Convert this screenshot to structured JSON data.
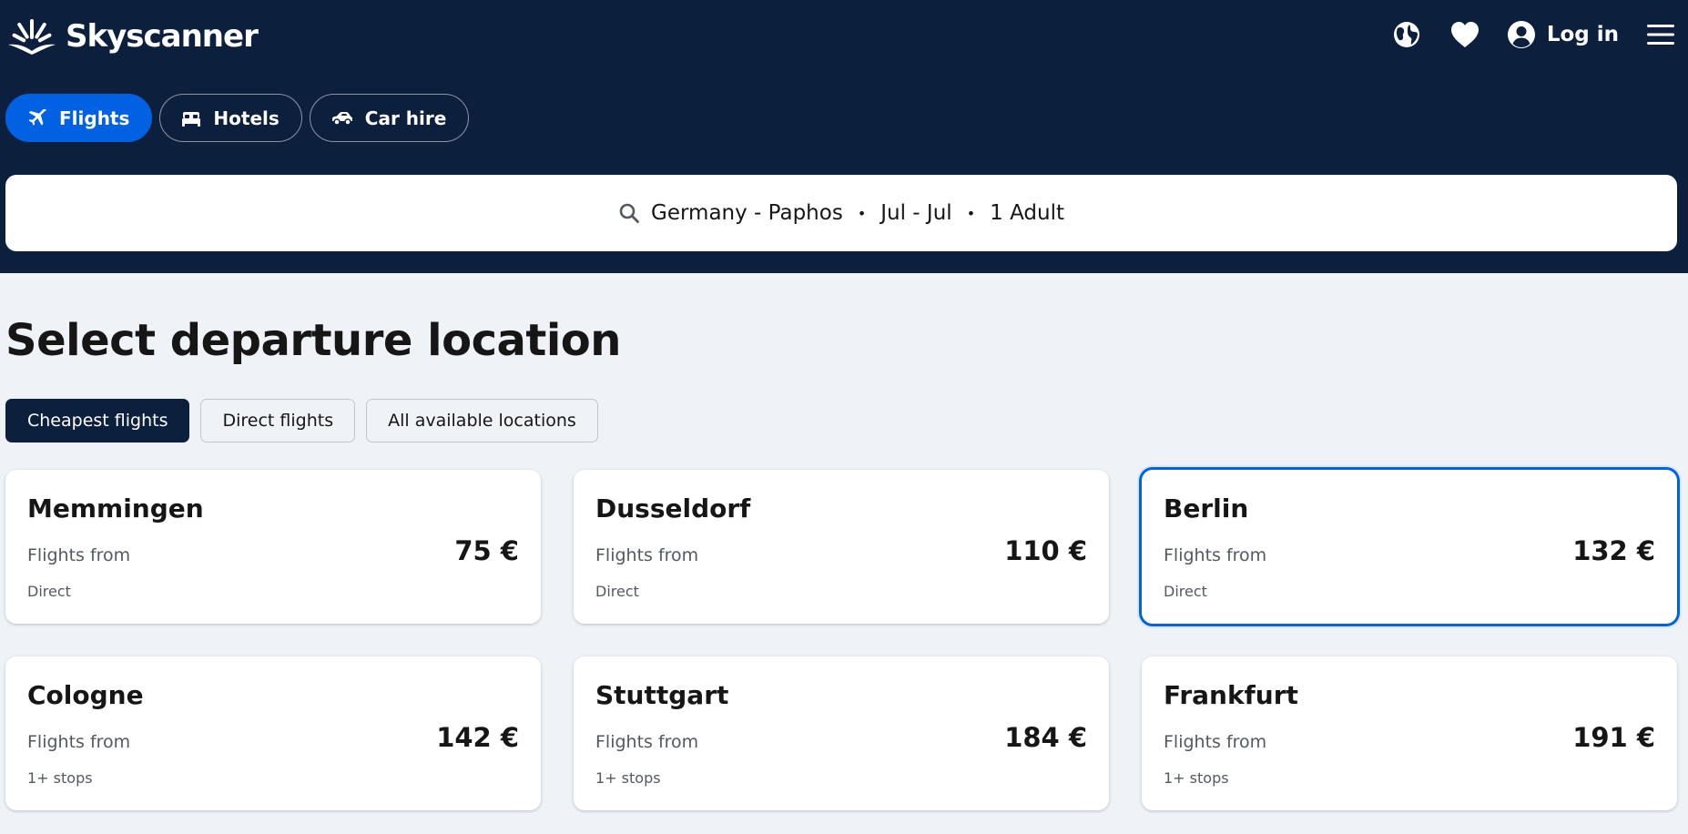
{
  "header": {
    "brand": "Skyscanner",
    "login_label": "Log in",
    "icons": [
      "globe-icon",
      "heart-icon",
      "account-icon",
      "menu-icon"
    ]
  },
  "tabs": [
    {
      "label": "Flights",
      "icon": "plane-icon",
      "active": true
    },
    {
      "label": "Hotels",
      "icon": "bed-icon",
      "active": false
    },
    {
      "label": "Car hire",
      "icon": "car-icon",
      "active": false
    }
  ],
  "search": {
    "route": "Germany - Paphos",
    "dates": "Jul - Jul",
    "travellers": "1 Adult",
    "separator": "•"
  },
  "main": {
    "title": "Select departure location",
    "filters": [
      {
        "label": "Cheapest flights",
        "active": true
      },
      {
        "label": "Direct flights",
        "active": false
      },
      {
        "label": "All available locations",
        "active": false
      }
    ],
    "cards": [
      {
        "city": "Memmingen",
        "from_label": "Flights from",
        "price": "75 €",
        "stops": "Direct",
        "selected": false
      },
      {
        "city": "Dusseldorf",
        "from_label": "Flights from",
        "price": "110 €",
        "stops": "Direct",
        "selected": false
      },
      {
        "city": "Berlin",
        "from_label": "Flights from",
        "price": "132 €",
        "stops": "Direct",
        "selected": true
      },
      {
        "city": "Cologne",
        "from_label": "Flights from",
        "price": "142 €",
        "stops": "1+ stops",
        "selected": false
      },
      {
        "city": "Stuttgart",
        "from_label": "Flights from",
        "price": "184 €",
        "stops": "1+ stops",
        "selected": false
      },
      {
        "city": "Frankfurt",
        "from_label": "Flights from",
        "price": "191 €",
        "stops": "1+ stops",
        "selected": false
      }
    ]
  },
  "colors": {
    "header_bg": "#0c1f3d",
    "accent": "#0062e3",
    "page_bg": "#eff3f8",
    "card_bg": "#ffffff",
    "text": "#161616",
    "muted_text": "#545860"
  }
}
